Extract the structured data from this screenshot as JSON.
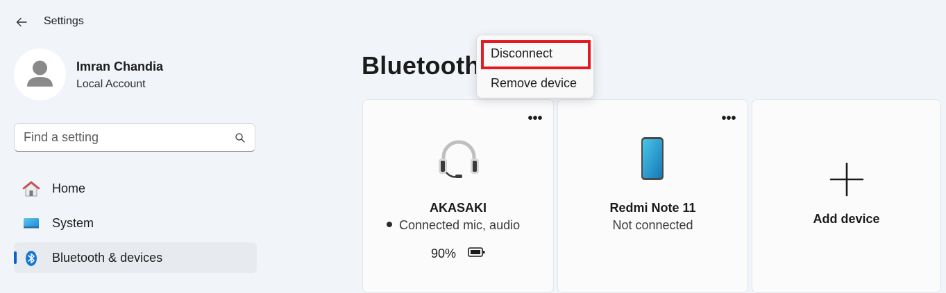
{
  "titlebar": {
    "title": "Settings"
  },
  "profile": {
    "name": "Imran Chandia",
    "account_type": "Local Account"
  },
  "search": {
    "placeholder": "Find a setting",
    "value": ""
  },
  "nav": {
    "items": [
      {
        "label": "Home",
        "icon": "home-icon"
      },
      {
        "label": "System",
        "icon": "system-icon"
      },
      {
        "label": "Bluetooth & devices",
        "icon": "bluetooth-icon",
        "active": true
      }
    ]
  },
  "page": {
    "title": "Bluetooth"
  },
  "context_menu": {
    "items": [
      {
        "label": "Disconnect",
        "highlighted": true
      },
      {
        "label": "Remove device"
      }
    ]
  },
  "devices": [
    {
      "name": "AKASAKI",
      "status": "Connected mic, audio",
      "battery": "90%",
      "icon": "headset-icon",
      "more": "•••"
    },
    {
      "name": "Redmi Note 11",
      "status": "Not connected",
      "icon": "phone-icon",
      "more": "•••"
    }
  ],
  "add_device": {
    "label": "Add device"
  },
  "colors": {
    "accent": "#0a63c9",
    "highlight_box": "#e01b24",
    "background": "#f1f4f9"
  }
}
